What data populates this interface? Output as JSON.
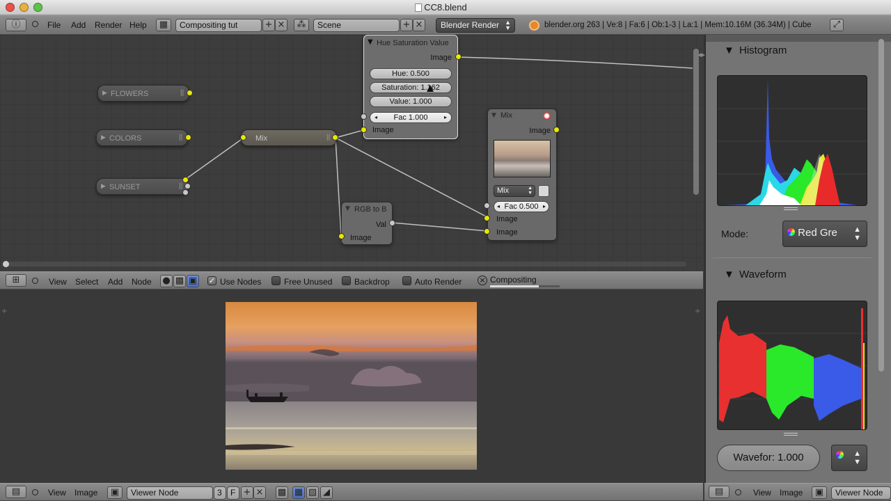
{
  "window": {
    "title": "CC8.blend"
  },
  "top_header": {
    "menus": [
      "File",
      "Add",
      "Render",
      "Help"
    ],
    "screen": "Compositing tut",
    "scene": "Scene",
    "engine": "Blender Render",
    "stats": "blender.org 263 | Ve:8 | Fa:6 | Ob:1-3 | La:1 | Mem:10.16M (36.34M) | Cube"
  },
  "node_editor": {
    "inputs": [
      {
        "name": "FLOWERS"
      },
      {
        "name": "COLORS"
      },
      {
        "name": "SUNSET"
      }
    ],
    "mix_node": {
      "title": "Mix"
    },
    "hsv_node": {
      "title": "Hue Saturation Value",
      "output": "Image",
      "hue": "Hue: 0.500",
      "saturation": "Saturation: 1.162",
      "value": "Value: 1.000",
      "fac": "Fac 1.000",
      "input": "Image"
    },
    "rgb_node": {
      "title": "RGB to B",
      "output": "Val",
      "input": "Image"
    },
    "mix2_node": {
      "title": "Mix",
      "output": "Image",
      "mode": "Mix",
      "fac": "Fac 0.500",
      "input1": "Image",
      "input2": "Image"
    }
  },
  "node_header": {
    "menus": [
      "View",
      "Select",
      "Add",
      "Node"
    ],
    "use_nodes": "Use Nodes",
    "free_unused": "Free Unused",
    "backdrop": "Backdrop",
    "auto_render": "Auto Render",
    "job": "Compositing",
    "use_nodes_checked": true
  },
  "image_header": {
    "menus": [
      "View",
      "Image"
    ],
    "image_name": "Viewer Node",
    "users": "3",
    "fake": "F"
  },
  "right_panel": {
    "histogram_title": "Histogram",
    "mode_label": "Mode:",
    "mode_value": "Red Gre",
    "waveform_title": "Waveform",
    "waveform_opacity": "Wavefor: 1.000",
    "footer_menus": [
      "View",
      "Image"
    ],
    "footer_image": "Viewer Node"
  },
  "colors": {
    "node_wire": "#d8d8d8",
    "socket_yellow": "#e8e800",
    "accent_blue": "#4a78d8"
  }
}
